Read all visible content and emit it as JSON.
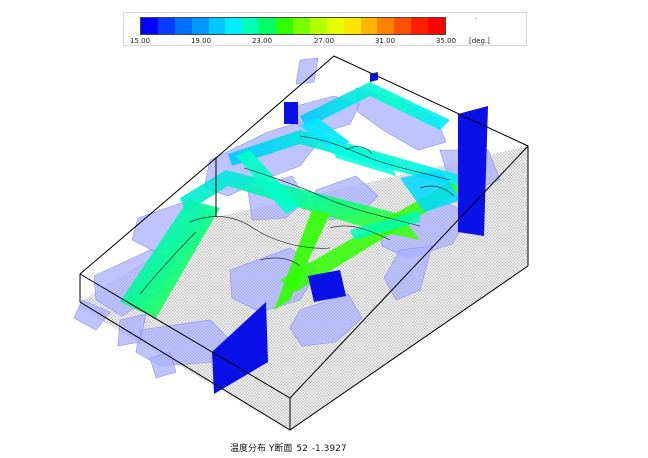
{
  "legend": {
    "colors": [
      "#0000ff",
      "#0a3cff",
      "#0070ff",
      "#0098ff",
      "#00c8ff",
      "#00ecff",
      "#00ffb4",
      "#00ff64",
      "#30ff00",
      "#78ff00",
      "#b4ff00",
      "#e6ff00",
      "#ffe600",
      "#ffb400",
      "#ff8200",
      "#ff5000",
      "#ff1e00",
      "#ff0000"
    ],
    "ticks": [
      "15.00",
      "19.00",
      "23.00",
      "27.00",
      "31.00",
      "35.00"
    ],
    "unit": "[deg.]",
    "dash": "-"
  },
  "caption": {
    "title": "温度分布 Y断面",
    "y_label": "52",
    "value": "-1.3927"
  }
}
